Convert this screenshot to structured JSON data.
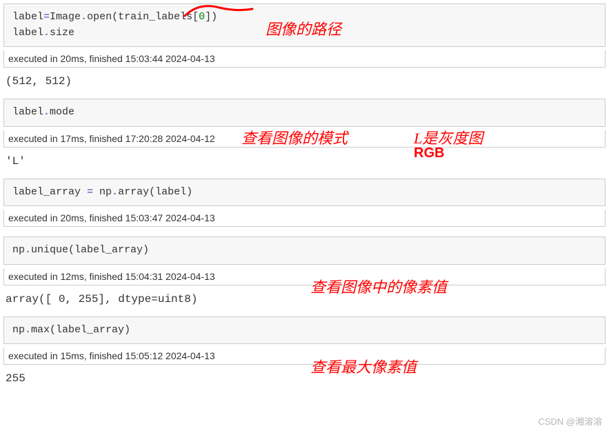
{
  "cells": [
    {
      "code_html": "label<span class='py-purple'>=</span>Image<span class='py-purple'>.</span>open(train_labels[<span class='py-green'>0</span>])\nlabel<span class='py-purple'>.</span>size",
      "exec": "executed in 20ms, finished 15:03:44 2024-04-13",
      "output": "(512, 512)"
    },
    {
      "code_html": "label<span class='py-purple'>.</span>mode",
      "exec": "executed in 17ms, finished 17:20:28 2024-04-12",
      "output": "'L'"
    },
    {
      "code_html": "label_array <span class='py-purple'>=</span> np<span class='py-purple'>.</span>array(label)",
      "exec": "executed in 20ms, finished 15:03:47 2024-04-13",
      "output": ""
    },
    {
      "code_html": "np<span class='py-purple'>.</span>unique(label_array)",
      "exec": "executed in 12ms, finished 15:04:31 2024-04-13",
      "output": "array([  0, 255], dtype=uint8)"
    },
    {
      "code_html": "np<span class='py-purple'>.</span>max(label_array)",
      "exec": "executed in 15ms, finished 15:05:12 2024-04-13",
      "output": "255"
    }
  ],
  "annotations": {
    "a1": "图像的路径",
    "a2": "查看图像的模式",
    "a3": "L是灰度图",
    "a4": "RGB",
    "a5": "查看图像中的像素值",
    "a6": "查看最大像素值"
  },
  "watermark": "CSDN @湘溶溶"
}
